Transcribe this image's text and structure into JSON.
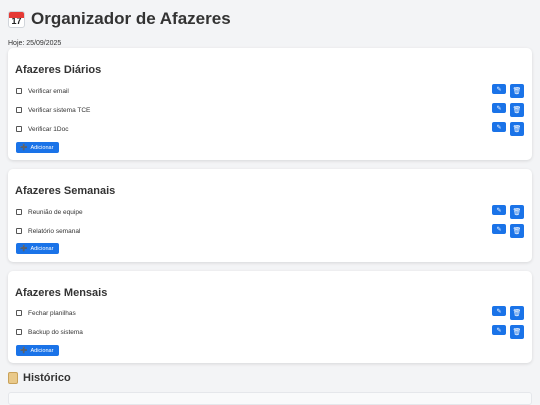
{
  "header": {
    "title": "Organizador de Afazeres",
    "icon_text": "17",
    "today": "Hoje: 25/09/2025"
  },
  "sections": [
    {
      "title": "Afazeres Diários",
      "tasks": [
        "Verificar email",
        "Verificar sistema TCE",
        "Verificar 1Doc"
      ],
      "add_label": "Adicionar"
    },
    {
      "title": "Afazeres Semanais",
      "tasks": [
        "Reunião de equipe",
        "Relatório semanal"
      ],
      "add_label": "Adicionar"
    },
    {
      "title": "Afazeres Mensais",
      "tasks": [
        "Fechar planilhas",
        "Backup do sistema"
      ],
      "add_label": "Adicionar"
    }
  ],
  "history": {
    "title": "Histórico"
  },
  "icons": {
    "edit": "pencil-icon",
    "delete": "trash-icon",
    "calendar": "calendar-icon",
    "scroll": "scroll-icon"
  },
  "colors": {
    "accent": "#1a73e8",
    "background": "#f3f4f6"
  }
}
